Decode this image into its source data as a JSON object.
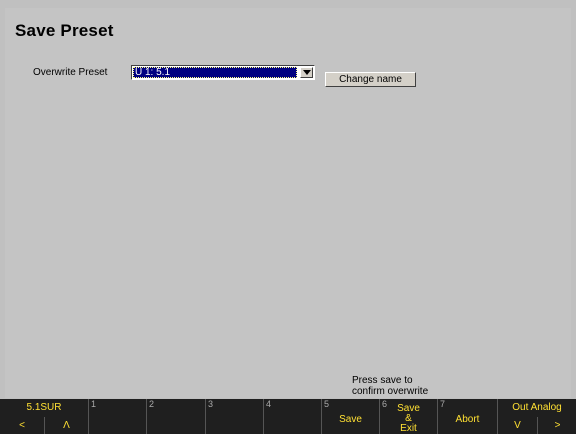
{
  "page": {
    "title": "Save Preset"
  },
  "form": {
    "overwrite_label": "Overwrite Preset",
    "preset_value": "U 1: 5.1",
    "change_name_label": "Change name"
  },
  "hint": {
    "line1": "Press save to",
    "line2": "confirm overwrite"
  },
  "fkeys": {
    "left": {
      "title": "5.1SUR",
      "prev": "<",
      "up": "Λ"
    },
    "k1": {
      "num": "1"
    },
    "k2": {
      "num": "2"
    },
    "k3": {
      "num": "3"
    },
    "k4": {
      "num": "4"
    },
    "k5": {
      "num": "5",
      "label": "Save"
    },
    "k6": {
      "num": "6",
      "line1": "Save",
      "line2": "&",
      "line3": "Exit"
    },
    "k7": {
      "num": "7",
      "label": "Abort"
    },
    "right": {
      "title": "Out Analog",
      "down": "V",
      "next": ">"
    }
  }
}
